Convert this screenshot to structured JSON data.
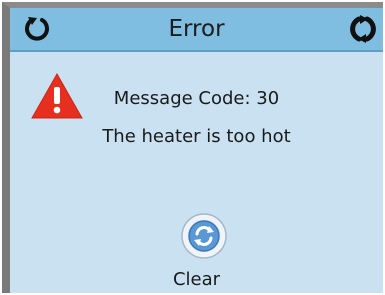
{
  "header": {
    "title": "Error",
    "left_icon": "restart-icon",
    "right_icon": "refresh-cycle-icon"
  },
  "message": {
    "icon": "warning-triangle-icon",
    "code_text": "Message Code: 30",
    "description": "The heater is too hot"
  },
  "actions": {
    "clear_label": "Clear",
    "clear_icon": "reset-circle-icon"
  },
  "colors": {
    "background": "#c9e1f1",
    "header": "#7fbde1",
    "warning": "#e62f1e"
  }
}
